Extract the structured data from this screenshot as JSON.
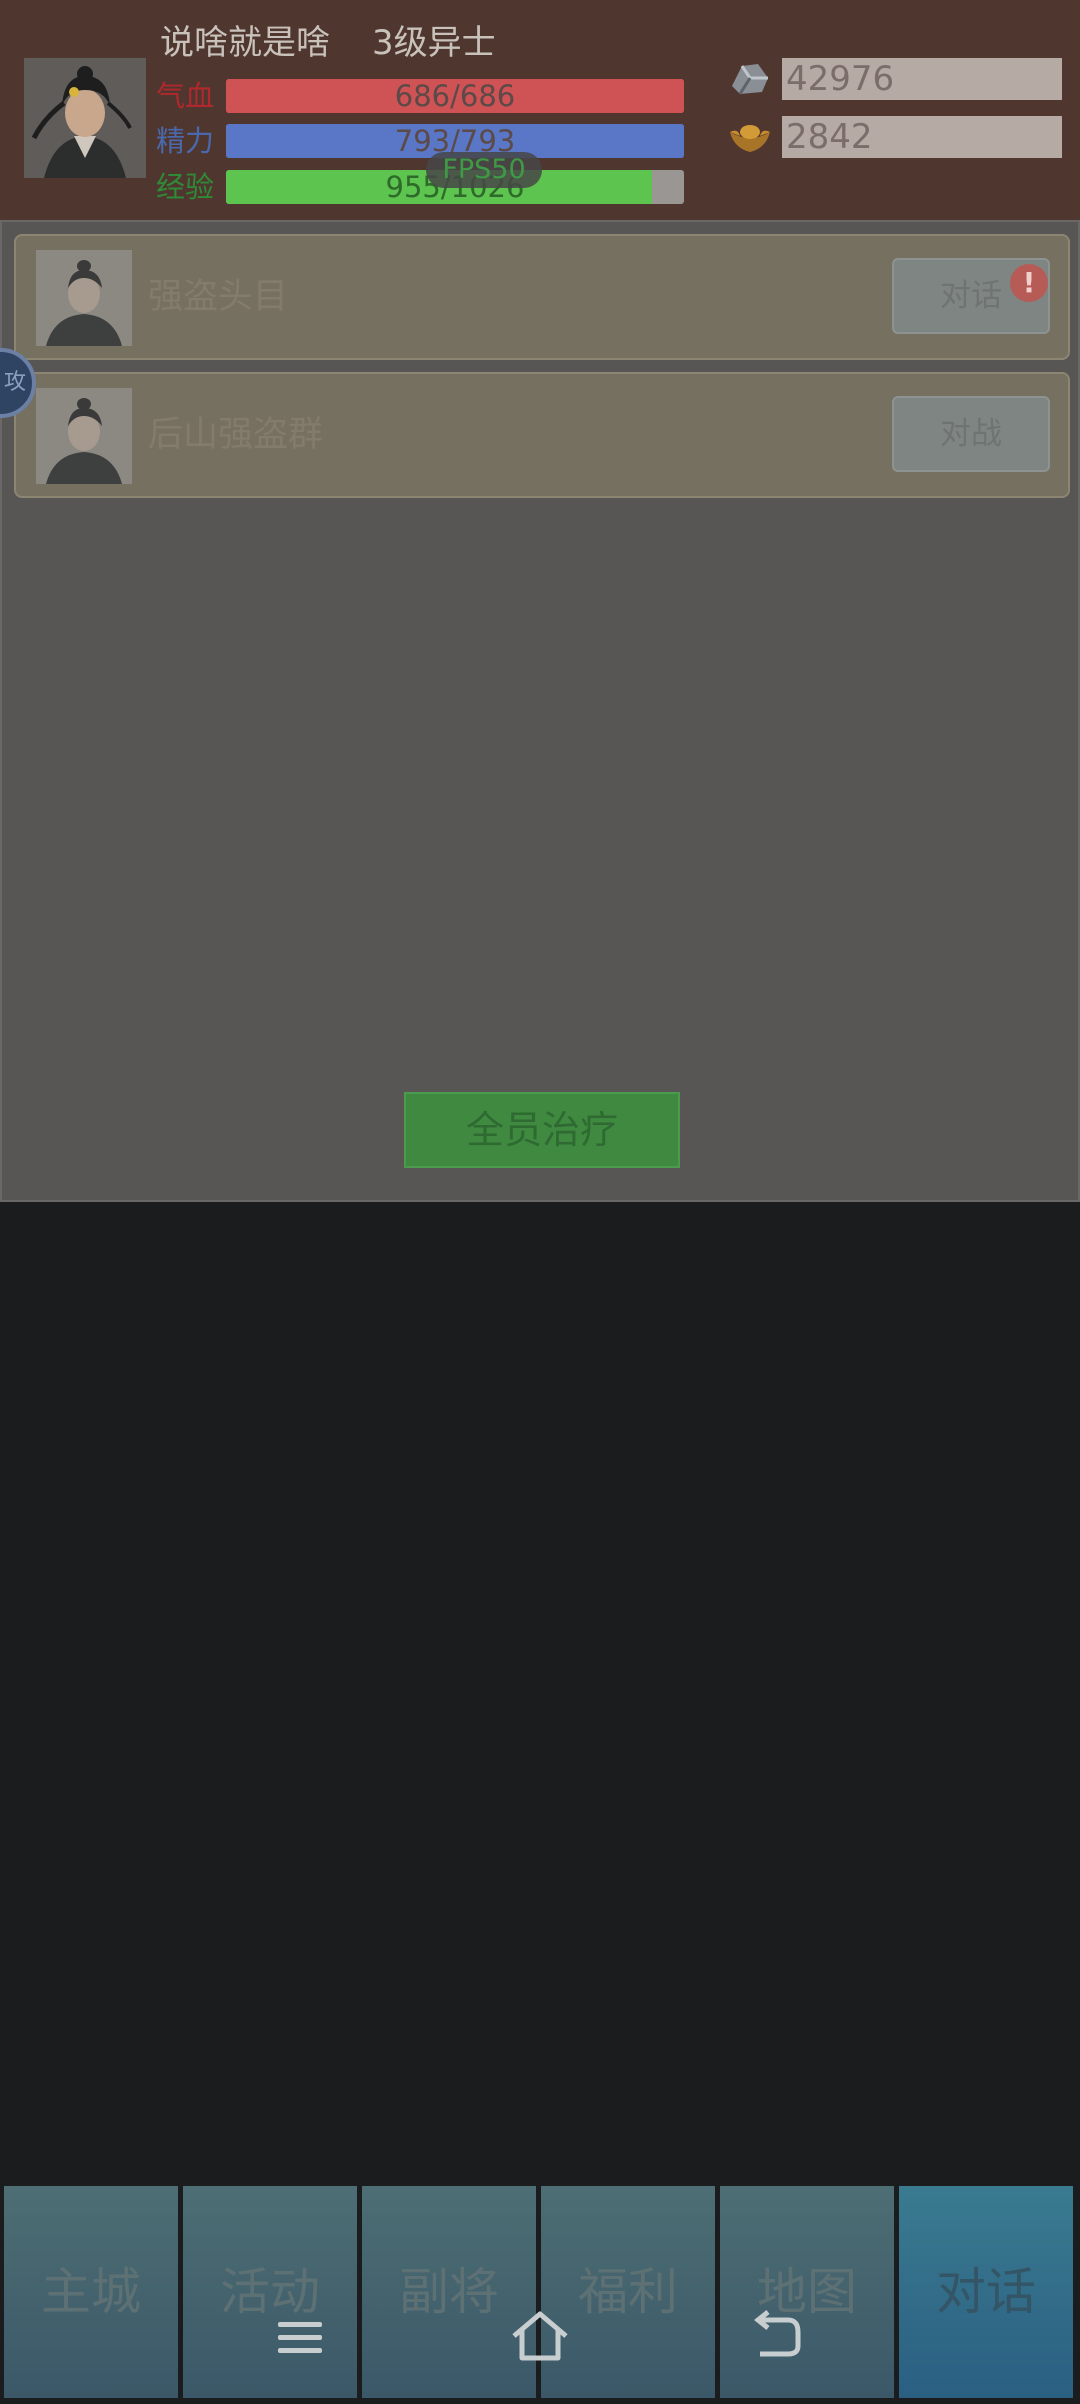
{
  "header": {
    "player_name": "说啥就是啥",
    "player_rank": "3级异士",
    "stats": [
      {
        "label": "气血",
        "value": "686/686",
        "ratio": 1.0,
        "color": "#cf5254",
        "label_color": "#b0282d"
      },
      {
        "label": "精力",
        "value": "793/793",
        "ratio": 1.0,
        "color": "#5a76c6",
        "label_color": "#4a69ad"
      },
      {
        "label": "经验",
        "value": "955/1026",
        "ratio": 0.931,
        "color": "#5dc44f",
        "label_color": "#2f8a35"
      }
    ],
    "fps": "FPS50",
    "resources": [
      {
        "icon": "silver-ore-icon",
        "value": "42976"
      },
      {
        "icon": "gold-ingot-icon",
        "value": "2842"
      }
    ]
  },
  "panel": {
    "rows": [
      {
        "name": "强盗头目",
        "button": "对话",
        "has_alert": true,
        "alert": "!"
      },
      {
        "name": "后山强盗群",
        "button": "对战",
        "has_alert": false
      }
    ],
    "heal_button": "全员治疗"
  },
  "side_float": "攻",
  "tabs": [
    {
      "label": "主城",
      "active": false
    },
    {
      "label": "活动",
      "active": false
    },
    {
      "label": "副将",
      "active": false
    },
    {
      "label": "福利",
      "active": false
    },
    {
      "label": "地图",
      "active": false
    },
    {
      "label": "对话",
      "active": true
    }
  ],
  "system_nav": [
    "menu-icon",
    "home-icon",
    "back-icon"
  ]
}
